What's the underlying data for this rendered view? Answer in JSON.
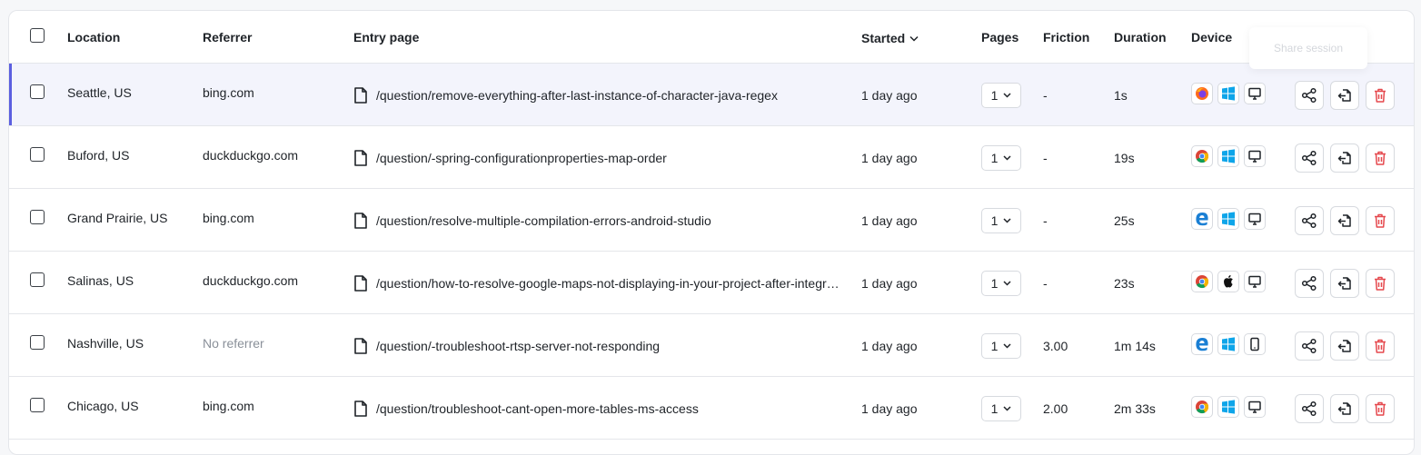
{
  "header": {
    "location": "Location",
    "referrer": "Referrer",
    "entry_page": "Entry page",
    "started": "Started",
    "pages": "Pages",
    "friction": "Friction",
    "duration": "Duration",
    "device": "Device"
  },
  "tooltip": "Share session",
  "colors": {
    "accent": "#5b5fe0",
    "delete": "#e5484d",
    "active_row": "#f3f4fc"
  },
  "rows": [
    {
      "location": "Seattle, US",
      "referrer": "bing.com",
      "entry": "/question/remove-everything-after-last-instance-of-character-java-regex",
      "started": "1 day ago",
      "pages": "1",
      "friction": "-",
      "duration": "1s",
      "browser": "firefox-icon",
      "os": "windows-icon",
      "device": "desktop-icon"
    },
    {
      "location": "Buford, US",
      "referrer": "duckduckgo.com",
      "entry": "/question/-spring-configurationproperties-map-order",
      "started": "1 day ago",
      "pages": "1",
      "friction": "-",
      "duration": "19s",
      "browser": "chrome-icon",
      "os": "windows-icon",
      "device": "desktop-icon"
    },
    {
      "location": "Grand Prairie, US",
      "referrer": "bing.com",
      "entry": "/question/resolve-multiple-compilation-errors-android-studio",
      "started": "1 day ago",
      "pages": "1",
      "friction": "-",
      "duration": "25s",
      "browser": "edge-icon",
      "os": "windows-icon",
      "device": "desktop-icon"
    },
    {
      "location": "Salinas, US",
      "referrer": "duckduckgo.com",
      "entry": "/question/how-to-resolve-google-maps-not-displaying-in-your-project-after-integration",
      "started": "1 day ago",
      "pages": "1",
      "friction": "-",
      "duration": "23s",
      "browser": "chrome-icon",
      "os": "apple-icon",
      "device": "desktop-icon"
    },
    {
      "location": "Nashville, US",
      "referrer": "No referrer",
      "entry": "/question/-troubleshoot-rtsp-server-not-responding",
      "started": "1 day ago",
      "pages": "1",
      "friction": "3.00",
      "duration": "1m 14s",
      "browser": "edge-icon",
      "os": "windows-icon",
      "device": "mobile-icon"
    },
    {
      "location": "Chicago, US",
      "referrer": "bing.com",
      "entry": "/question/troubleshoot-cant-open-more-tables-ms-access",
      "started": "1 day ago",
      "pages": "1",
      "friction": "2.00",
      "duration": "2m 33s",
      "browser": "chrome-icon",
      "os": "windows-icon",
      "device": "desktop-icon"
    }
  ]
}
